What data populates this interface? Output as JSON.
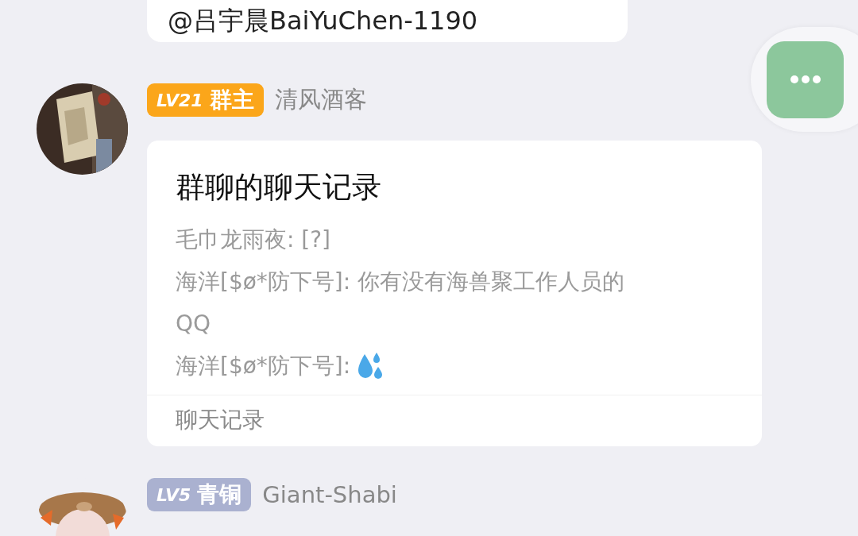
{
  "top_message": {
    "text": "@吕宇晨BaiYuChen-1190"
  },
  "more_button": {
    "kind": "dots"
  },
  "messages": [
    {
      "level": "LV21",
      "role": "群主",
      "color": "#fba61a",
      "name": "清风酒客",
      "card": {
        "title": "群聊的聊天记录",
        "lines": [
          {
            "text": "毛巾龙雨夜: [?]",
            "drops_icon": false
          },
          {
            "text": "海洋[$ø*防下号]: 你有没有海兽聚工作人员的QQ",
            "drops_icon": false
          },
          {
            "text": "海洋[$ø*防下号]:",
            "drops_icon": true
          }
        ],
        "footer": "聊天记录"
      }
    },
    {
      "level": "LV5",
      "role": "青铜",
      "color": "#aab1d0",
      "name": "Giant-Shabi"
    }
  ]
}
